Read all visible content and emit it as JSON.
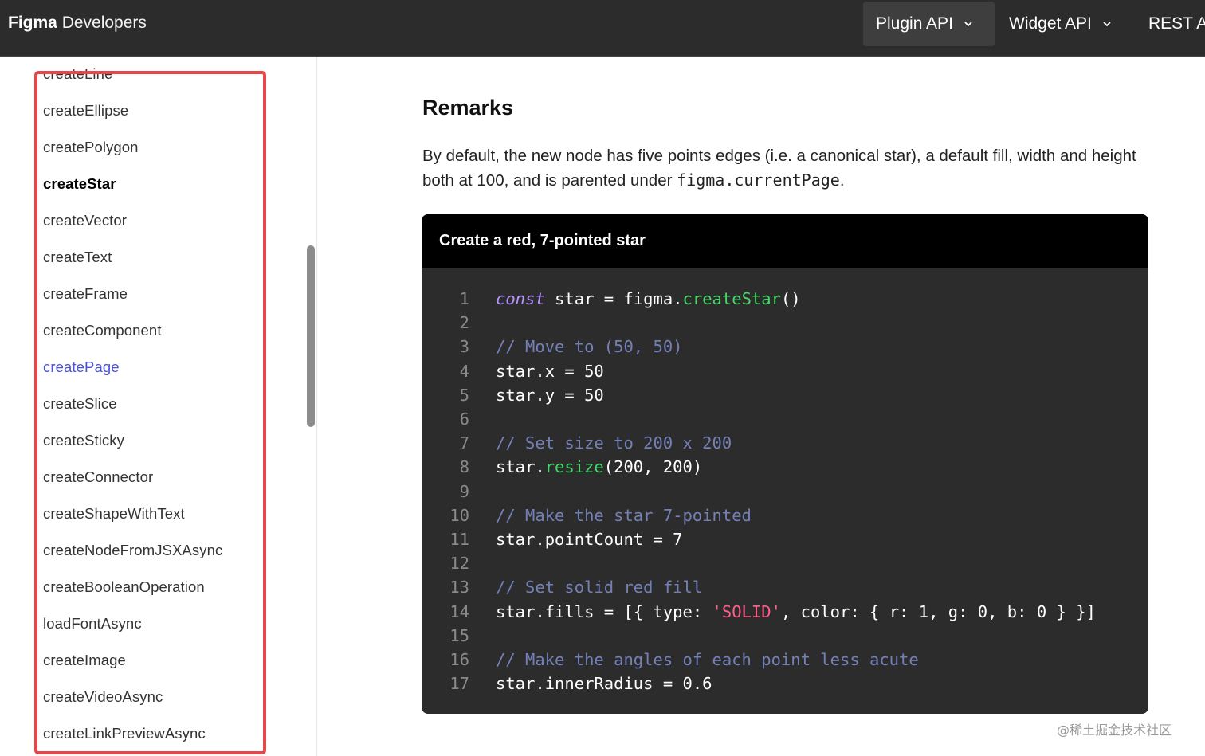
{
  "header": {
    "brand_bold": "Figma",
    "brand_light": "Developers",
    "nav": [
      {
        "label": "Plugin API"
      },
      {
        "label": "Widget API"
      },
      {
        "label": "REST A"
      }
    ]
  },
  "sidebar": {
    "items": [
      "createLine",
      "createEllipse",
      "createPolygon",
      "createStar",
      "createVector",
      "createText",
      "createFrame",
      "createComponent",
      "createPage",
      "createSlice",
      "createSticky",
      "createConnector",
      "createShapeWithText",
      "createNodeFromJSXAsync",
      "createBooleanOperation",
      "loadFontAsync",
      "createImage",
      "createVideoAsync",
      "createLinkPreviewAsync"
    ],
    "current_item": "createStar",
    "hover_item": "createPage"
  },
  "main": {
    "title": "Remarks",
    "remarks_text": "By default, the new node has five points edges (i.e. a canonical star), a default fill, width and height both at 100, and is parented under ",
    "remarks_code": "figma.currentPage",
    "remarks_end": ".",
    "example_title": "Create a red, 7-pointed star",
    "code_lines": [
      {
        "n": "1",
        "tokens": [
          {
            "t": "kw",
            "v": "const"
          },
          {
            "t": "",
            "v": " star = figma."
          },
          {
            "t": "fn",
            "v": "createStar"
          },
          {
            "t": "",
            "v": "()"
          }
        ]
      },
      {
        "n": "2",
        "tokens": []
      },
      {
        "n": "3",
        "tokens": [
          {
            "t": "cm",
            "v": "// Move to (50, 50)"
          }
        ]
      },
      {
        "n": "4",
        "tokens": [
          {
            "t": "",
            "v": "star.x = 50"
          }
        ]
      },
      {
        "n": "5",
        "tokens": [
          {
            "t": "",
            "v": "star.y = 50"
          }
        ]
      },
      {
        "n": "6",
        "tokens": []
      },
      {
        "n": "7",
        "tokens": [
          {
            "t": "cm",
            "v": "// Set size to 200 x 200"
          }
        ]
      },
      {
        "n": "8",
        "tokens": [
          {
            "t": "",
            "v": "star."
          },
          {
            "t": "fn",
            "v": "resize"
          },
          {
            "t": "",
            "v": "(200, 200)"
          }
        ]
      },
      {
        "n": "9",
        "tokens": []
      },
      {
        "n": "10",
        "tokens": [
          {
            "t": "cm",
            "v": "// Make the star 7-pointed"
          }
        ]
      },
      {
        "n": "11",
        "tokens": [
          {
            "t": "",
            "v": "star.pointCount = 7"
          }
        ]
      },
      {
        "n": "12",
        "tokens": []
      },
      {
        "n": "13",
        "tokens": [
          {
            "t": "cm",
            "v": "// Set solid red fill"
          }
        ]
      },
      {
        "n": "14",
        "tokens": [
          {
            "t": "",
            "v": "star.fills = [{ type: "
          },
          {
            "t": "str",
            "v": "'SOLID'"
          },
          {
            "t": "",
            "v": ", color: { r: 1, g: 0, b: 0 } }]"
          }
        ]
      },
      {
        "n": "15",
        "tokens": []
      },
      {
        "n": "16",
        "tokens": [
          {
            "t": "cm",
            "v": "// Make the angles of each point less acute"
          }
        ]
      },
      {
        "n": "17",
        "tokens": [
          {
            "t": "",
            "v": "star.innerRadius = 0.6"
          }
        ]
      }
    ]
  },
  "watermark": "@稀土掘金技术社区",
  "colors": {
    "header_bg": "#2c2c2c",
    "highlight_border": "#e8474a",
    "link_hover": "#4a52d9",
    "code_bg": "#2c2c2c",
    "code_keyword": "#b793ff",
    "code_function": "#49d66a",
    "code_comment": "#7480b8",
    "code_string": "#ff5c8a"
  }
}
